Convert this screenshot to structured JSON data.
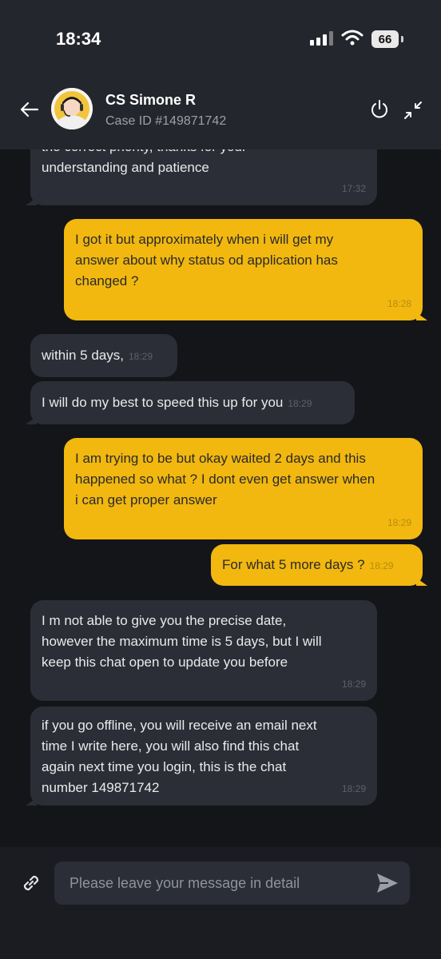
{
  "status_bar": {
    "time": "18:34",
    "battery": "66"
  },
  "header": {
    "agent_name": "CS Simone R",
    "case_id": "Case ID #149871742",
    "icons": [
      "back-arrow-icon",
      "power-icon",
      "minimize-icon"
    ]
  },
  "messages": [
    {
      "sender": "agent",
      "text": "the correct priority, thanks for your\nunderstanding and patience",
      "time": "17:32"
    },
    {
      "sender": "user",
      "text": "I got it but approximately when i will get my\nanswer about why status od application has\nchanged ?",
      "time": "18:28"
    },
    {
      "sender": "agent",
      "text": "within 5 days,",
      "time": "18:29"
    },
    {
      "sender": "agent",
      "text": "I will do my best to speed this up for you",
      "time": "18:29"
    },
    {
      "sender": "user",
      "text": "I am trying to be but okay waited 2 days and this\nhappened so what ? I dont even get answer when\ni can get proper answer",
      "time": "18:29"
    },
    {
      "sender": "user",
      "text": "For what 5 more days ?",
      "time": "18:29"
    },
    {
      "sender": "agent",
      "text": "I m not able to give you the precise date,\nhowever the maximum time is 5 days, but I will\nkeep this chat open to update you before",
      "time": "18:29"
    },
    {
      "sender": "agent",
      "text": "if you go offline, you will receive an email next\ntime I write here, you will also find this chat\nagain next time you login, this is the chat\nnumber 149871742",
      "time": "18:29"
    }
  ],
  "composer": {
    "placeholder": "Please leave your message in detail",
    "value": ""
  },
  "colors": {
    "agent_bubble": "#2b2e36",
    "user_bubble": "#f2b80f",
    "background": "#141519",
    "header": "#24262d"
  }
}
